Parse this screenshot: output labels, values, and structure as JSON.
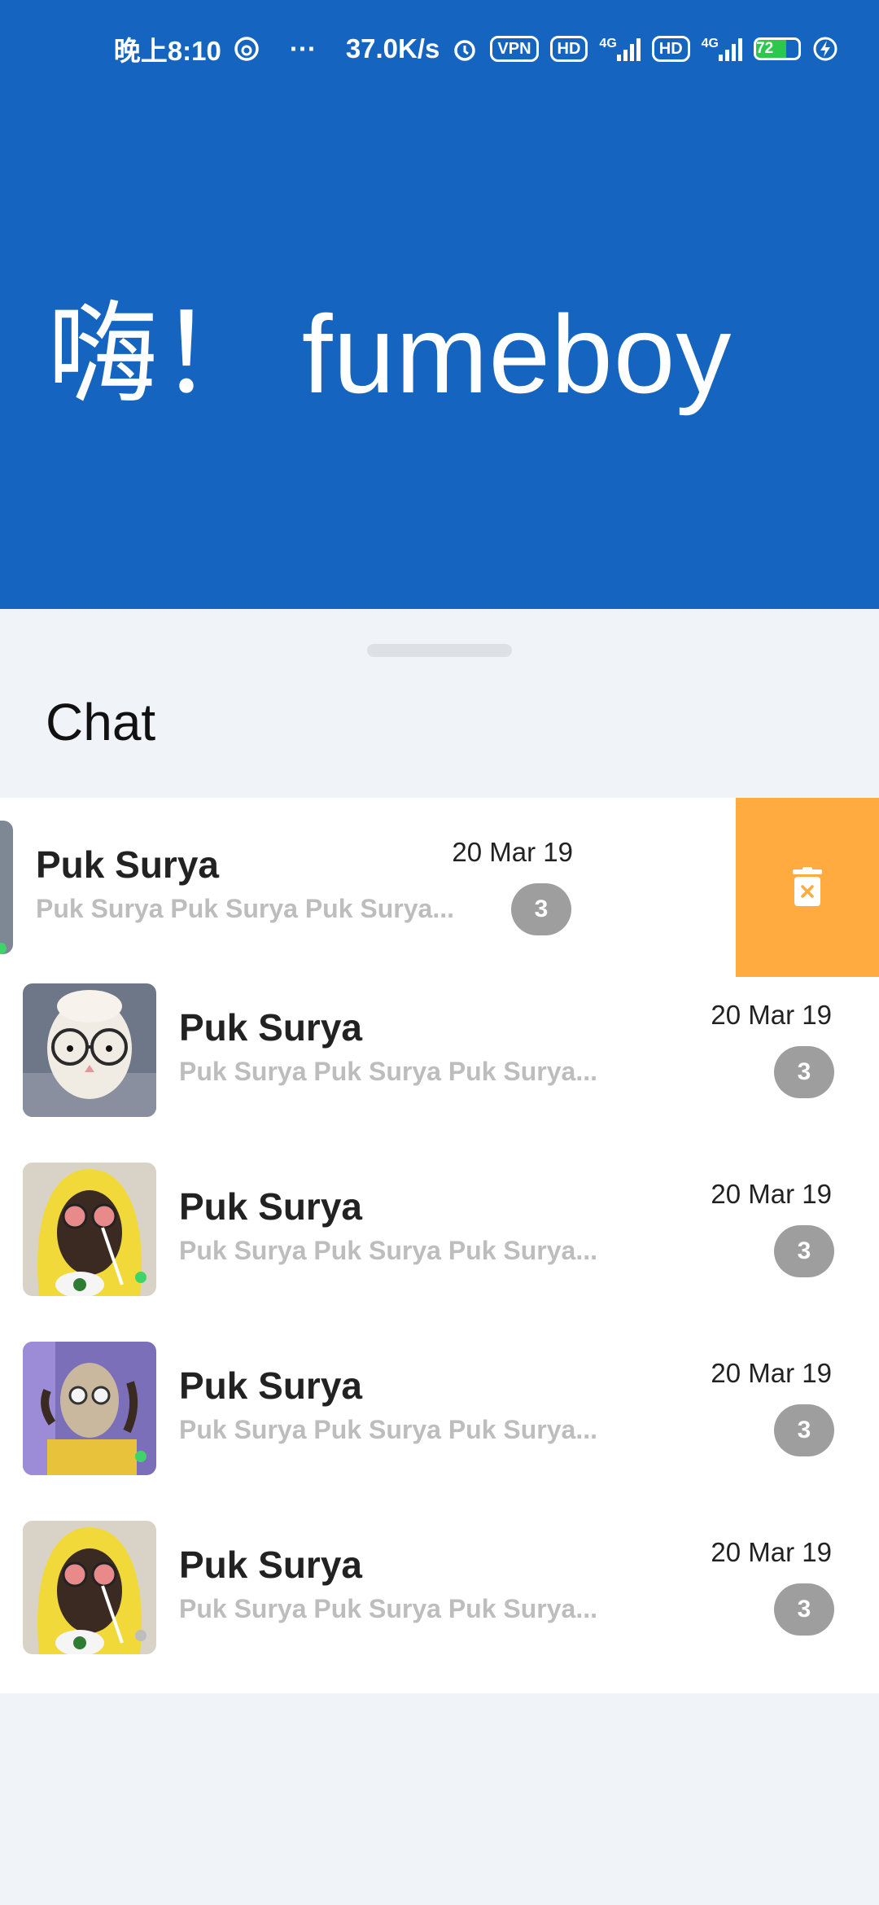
{
  "status_bar": {
    "time": "晚上8:10",
    "dots": "···",
    "speed": "37.0K/s",
    "vpn": "VPN",
    "hd1": "HD",
    "net1": "4G",
    "hd2": "HD",
    "net2": "4G",
    "battery": "72",
    "battery_level": 0.72
  },
  "header": {
    "greeting": "嗨！ fumeboy",
    "background_color": "#1565C0"
  },
  "chat": {
    "title": "Chat",
    "swipe_action_color": "#FFAB40",
    "items": [
      {
        "name": "Puk Surya",
        "preview": "Puk Surya Puk Surya Puk Surya...",
        "date": "20 Mar 19",
        "unread": "3",
        "avatar": "goat-glasses",
        "online": true,
        "swiped": true
      },
      {
        "name": "Puk Surya",
        "preview": "Puk Surya Puk Surya Puk Surya...",
        "date": "20 Mar 19",
        "unread": "3",
        "avatar": "goat-glasses",
        "online": false,
        "swiped": false
      },
      {
        "name": "Puk Surya",
        "preview": "Puk Surya Puk Surya Puk Surya...",
        "date": "20 Mar 19",
        "unread": "3",
        "avatar": "yellow-hoodie",
        "online": true,
        "swiped": false
      },
      {
        "name": "Puk Surya",
        "preview": "Puk Surya Puk Surya Puk Surya...",
        "date": "20 Mar 19",
        "unread": "3",
        "avatar": "purple-room",
        "online": true,
        "swiped": false
      },
      {
        "name": "Puk Surya",
        "preview": "Puk Surya Puk Surya Puk Surya...",
        "date": "20 Mar 19",
        "unread": "3",
        "avatar": "yellow-hoodie",
        "online": false,
        "swiped": false
      }
    ]
  }
}
